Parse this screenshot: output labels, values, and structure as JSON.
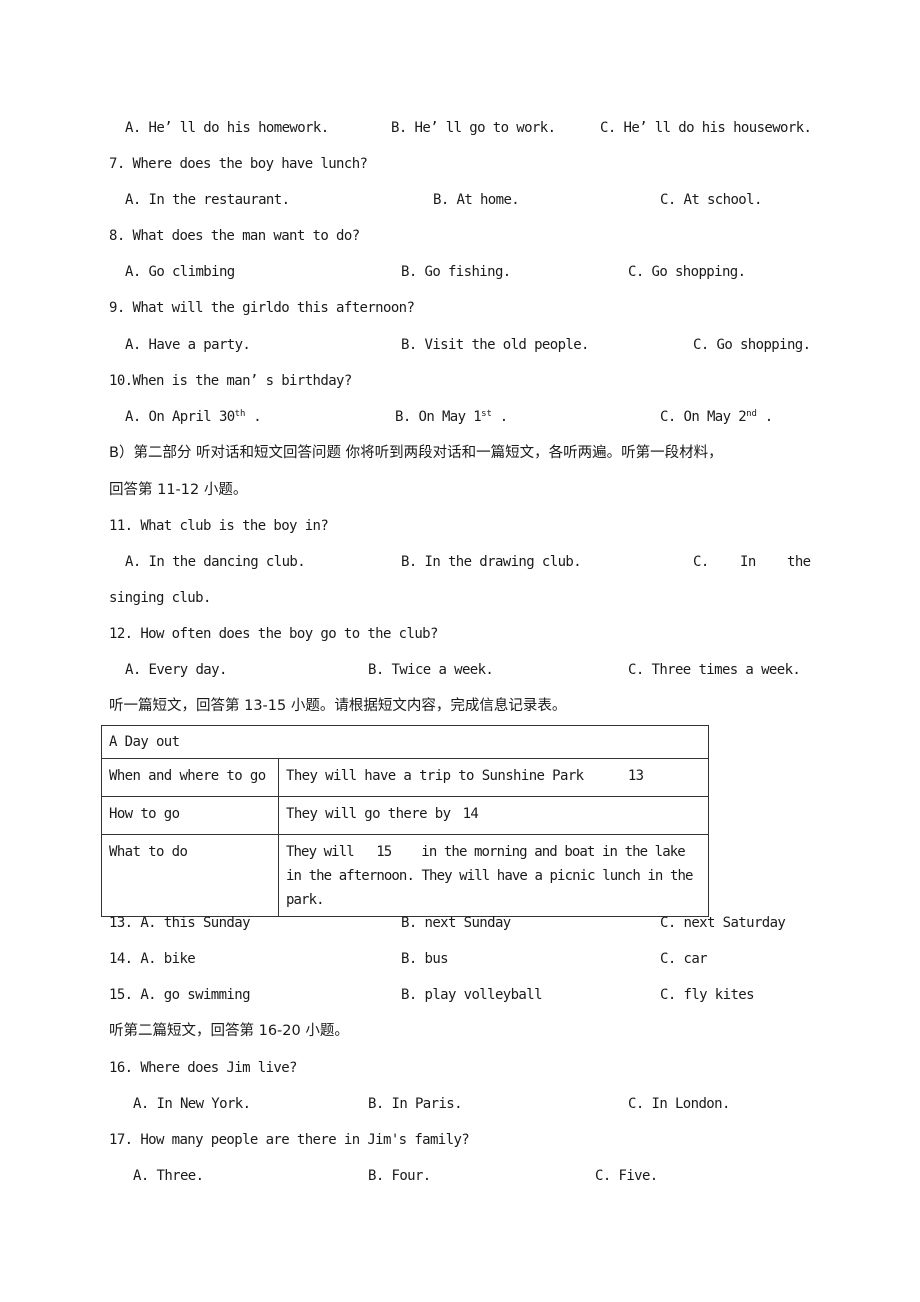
{
  "document": {
    "q6_options": [
      "A. He’ ll do his homework.",
      "B. He’ ll go to work.",
      "C. He’ ll do his housework."
    ],
    "q7": {
      "question": "7. Where does the boy have lunch?",
      "options": [
        "A. In the restaurant.",
        "B. At home.",
        "C. At school."
      ]
    },
    "q8": {
      "question": "8. What does the man want to do?",
      "options": [
        "A. Go climbing",
        "B. Go fishing.",
        "C. Go shopping."
      ]
    },
    "q9": {
      "question": "9. What will the girldo this afternoon?",
      "options": [
        "A. Have a party.",
        "B. Visit the old people.",
        "C. Go shopping."
      ]
    },
    "q10": {
      "question": "10.When is the man’ s birthday?",
      "options": [
        {
          "prefix": "A. On April 30",
          "sup": "th",
          "suffix": " ."
        },
        {
          "prefix": "B. On May 1",
          "sup": "st",
          "suffix": " ."
        },
        {
          "prefix": "C. On May 2",
          "sup": "nd",
          "suffix": " ."
        }
      ]
    },
    "section_b": {
      "line1": "B）第二部分 听对话和短文回答问题  你将听到两段对话和一篇短文，各听两遍。听第一段材料，",
      "line2": "回答第 11-12 小题。"
    },
    "q11": {
      "question": "11. What club is the boy in?",
      "options": [
        "A. In the dancing club.",
        "B. In the drawing club.",
        "C.",
        "In",
        "the"
      ],
      "wrap": "singing club."
    },
    "q12": {
      "question": "12. How often does the boy go to the club?",
      "options": [
        "A. Every day.",
        "B. Twice a week.",
        "C. Three times a week."
      ]
    },
    "passage1_instruction": "听一篇短文，回答第 13-15 小题。请根据短文内容，完成信息记录表。",
    "info_table": {
      "title": "A Day out",
      "rows": [
        {
          "key": "When and where to go",
          "value_before": "They will have a trip to Sunshine Park",
          "blank": "13",
          "value_after": ""
        },
        {
          "key": "How to go",
          "value_before": "They will go there by",
          "blank": "14",
          "value_after": ""
        },
        {
          "key": "What to do",
          "value_before": "They will",
          "blank": "15",
          "value_after": "in the morning and boat in the lake in the afternoon. They will have a picnic lunch in the park."
        }
      ]
    },
    "q13": {
      "label": "13. A. this Sunday",
      "options": [
        "B. next Sunday",
        "C. next Saturday"
      ]
    },
    "q14": {
      "label": "14. A. bike",
      "options": [
        "B. bus",
        "C. car"
      ]
    },
    "q15": {
      "label": "15. A. go swimming",
      "options": [
        "B. play volleyball",
        "C. fly kites"
      ]
    },
    "passage2_instruction": "听第二篇短文，回答第 16-20 小题。",
    "q16": {
      "question": "16. Where does Jim live?",
      "options": [
        "A. In New York.",
        "B. In Paris.",
        "C. In London."
      ]
    },
    "q17": {
      "question": "17. How many people are there in Jim's family?",
      "options": [
        "A. Three.",
        "B. Four.",
        "C. Five."
      ]
    }
  }
}
